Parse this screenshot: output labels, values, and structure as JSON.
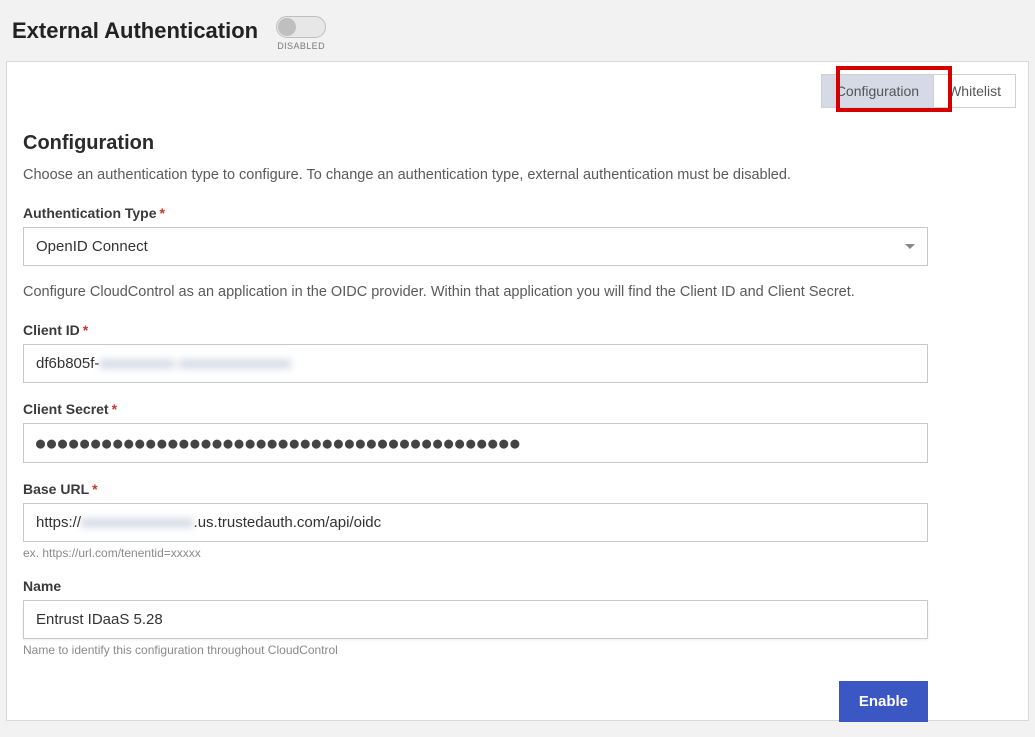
{
  "header": {
    "title": "External Authentication",
    "toggle_state_label": "DISABLED"
  },
  "tabs": {
    "configuration": "Configuration",
    "whitelist": "Whitelist"
  },
  "section": {
    "title": "Configuration",
    "description": "Choose an authentication type to configure. To change an authentication type, external authentication must be disabled."
  },
  "auth_type": {
    "label": "Authentication Type",
    "value": "OpenID Connect"
  },
  "oidc_note": "Configure CloudControl as an application in the OIDC provider. Within that application you will find the Client ID and Client Secret.",
  "client_id": {
    "label": "Client ID",
    "prefix": "df6b805f-",
    "masked": "xxxxxxxxxx xxxxxxxxxxxxxxx"
  },
  "client_secret": {
    "label": "Client Secret",
    "value": "●●●●●●●●●●●●●●●●●●●●●●●●●●●●●●●●●●●●●●●●●●●●"
  },
  "base_url": {
    "label": "Base URL",
    "prefix": "https://",
    "masked": "xxxxxxxxxxxxxxx",
    "suffix": ".us.trustedauth.com/api/oidc",
    "helper": "ex. https://url.com/tenentid=xxxxx"
  },
  "name": {
    "label": "Name",
    "value": "Entrust IDaaS 5.28",
    "helper": "Name to identify this configuration throughout CloudControl"
  },
  "actions": {
    "enable": "Enable"
  }
}
